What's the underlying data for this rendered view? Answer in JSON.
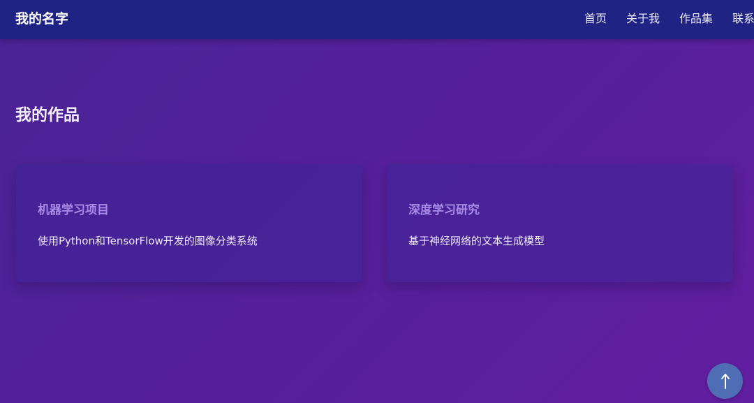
{
  "nav": {
    "brand": "我的名字",
    "links": [
      {
        "label": "首页"
      },
      {
        "label": "关于我"
      },
      {
        "label": "作品集"
      },
      {
        "label": "联系"
      }
    ]
  },
  "portfolio": {
    "title": "我的作品",
    "cards": [
      {
        "title": "机器学习项目",
        "description": "使用Python和TensorFlow开发的图像分类系统"
      },
      {
        "title": "深度学习研究",
        "description": "基于神经网络的文本生成模型"
      }
    ]
  },
  "back_to_top": {
    "icon": "arrow-up-icon"
  },
  "colors": {
    "navbar": "#1f2384",
    "background": "#54209a",
    "card_title": "#a78be6",
    "back_to_top": "#4f6db4"
  }
}
